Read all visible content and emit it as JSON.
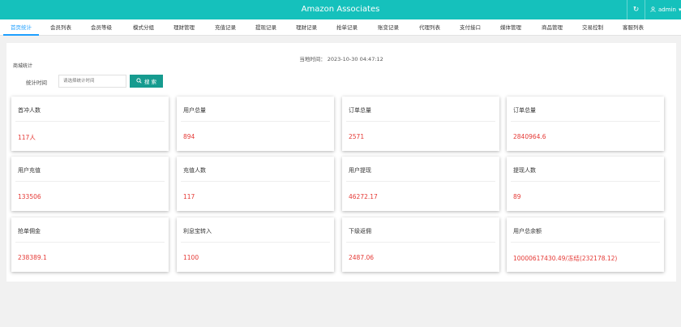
{
  "header": {
    "title": "Amazon Associates",
    "refresh_icon": "↻",
    "user_icon": "user-icon",
    "username": "admin",
    "caret": "▾"
  },
  "tabs": [
    {
      "label": "首页统计",
      "active": true
    },
    {
      "label": "会员列表"
    },
    {
      "label": "会员等级"
    },
    {
      "label": "模式分组"
    },
    {
      "label": "理财管理"
    },
    {
      "label": "充值记录"
    },
    {
      "label": "提现记录"
    },
    {
      "label": "理财记录"
    },
    {
      "label": "抢单记录"
    },
    {
      "label": "账变记录"
    },
    {
      "label": "代理列表"
    },
    {
      "label": "支付接口"
    },
    {
      "label": "媒体管理"
    },
    {
      "label": "商品管理"
    },
    {
      "label": "交易控制"
    },
    {
      "label": "客服列表"
    }
  ],
  "main": {
    "current_time": "当地时间： 2023-10-30 04:47:12",
    "section_title": "商城统计",
    "filter": {
      "label": "统计时间",
      "placeholder": "请选择统计时间",
      "button_label": "搜 索"
    },
    "cards": [
      {
        "title": "首冲人数",
        "value": "117人"
      },
      {
        "title": "用户总量",
        "value": "894"
      },
      {
        "title": "订单总量",
        "value": "2571"
      },
      {
        "title": "订单总量",
        "value": "2840964.6"
      },
      {
        "title": "用户充值",
        "value": "133506"
      },
      {
        "title": "充值人数",
        "value": "117"
      },
      {
        "title": "用户提现",
        "value": "46272.17"
      },
      {
        "title": "提现人数",
        "value": "89"
      },
      {
        "title": "抢单佣金",
        "value": "238389.1"
      },
      {
        "title": "利息宝转入",
        "value": "1100"
      },
      {
        "title": "下级返佣",
        "value": "2487.06"
      },
      {
        "title": "用户总余额",
        "value": "10000617430.49/冻结(232178.12)"
      }
    ]
  },
  "colors": {
    "header_bg": "#15c1bc",
    "active_tab": "#1e9fff",
    "button_bg": "#169b8f",
    "value_red": "#e53935"
  }
}
